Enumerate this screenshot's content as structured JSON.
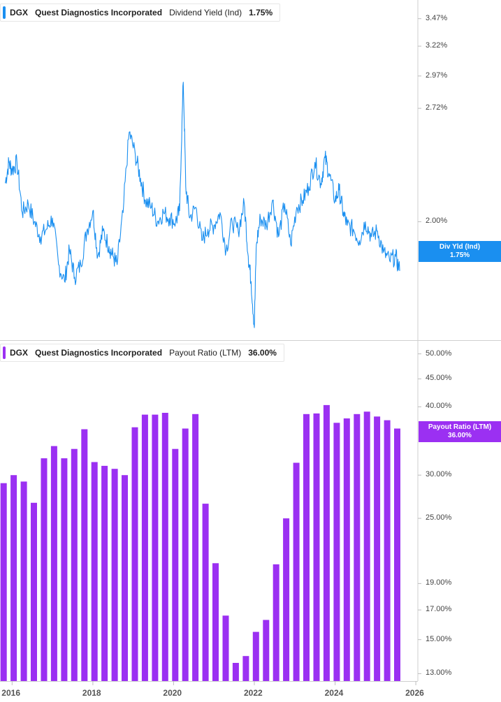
{
  "top_panel": {
    "ticker": "DGX",
    "company": "Quest Diagnostics Incorporated",
    "metric": "Dividend Yield (Ind)",
    "value": "1.75%",
    "flag_label": "Div Yld (Ind)",
    "flag_value": "1.75%",
    "color": "#1a8ff0"
  },
  "bottom_panel": {
    "ticker": "DGX",
    "company": "Quest Diagnostics Incorporated",
    "metric": "Payout Ratio (LTM)",
    "value": "36.00%",
    "flag_label": "Payout Ratio (LTM)",
    "flag_value": "36.00%",
    "color": "#9b30f2"
  },
  "chart_data": [
    {
      "type": "line",
      "scale": "log",
      "series": [
        {
          "name": "Dividend Yield (Ind)",
          "x": [
            2015.83,
            2015.92,
            2016.0,
            2016.12,
            2016.25,
            2016.4,
            2016.55,
            2016.7,
            2016.85,
            2017.0,
            2017.15,
            2017.3,
            2017.42,
            2017.55,
            2017.7,
            2017.85,
            2018.0,
            2018.12,
            2018.25,
            2018.4,
            2018.5,
            2018.6,
            2018.75,
            2018.9,
            2019.05,
            2019.18,
            2019.3,
            2019.45,
            2019.6,
            2019.75,
            2019.9,
            2020.05,
            2020.15,
            2020.24,
            2020.3,
            2020.4,
            2020.55,
            2020.7,
            2020.85,
            2021.0,
            2021.15,
            2021.3,
            2021.45,
            2021.6,
            2021.75,
            2021.85,
            2021.92,
            2022.0,
            2022.05,
            2022.15,
            2022.3,
            2022.45,
            2022.6,
            2022.75,
            2022.9,
            2023.05,
            2023.2,
            2023.35,
            2023.5,
            2023.65,
            2023.75,
            2023.85,
            2024.0,
            2024.1,
            2024.2,
            2024.3,
            2024.45,
            2024.6,
            2024.75,
            2024.9,
            2025.05,
            2025.2,
            2025.35,
            2025.5,
            2025.6
          ],
          "y": [
            2.22,
            2.35,
            2.3,
            2.35,
            2.05,
            2.1,
            2.0,
            1.92,
            1.96,
            2.02,
            1.78,
            1.7,
            1.85,
            1.72,
            1.78,
            1.95,
            2.06,
            1.82,
            1.95,
            1.87,
            1.82,
            1.78,
            2.05,
            2.55,
            2.4,
            2.25,
            2.12,
            2.08,
            2.0,
            2.05,
            2.02,
            2.0,
            2.06,
            2.92,
            2.2,
            2.02,
            2.08,
            1.9,
            1.96,
            1.98,
            2.05,
            1.85,
            2.0,
            1.95,
            2.1,
            1.82,
            1.7,
            1.5,
            1.88,
            2.02,
            1.98,
            2.12,
            1.92,
            2.1,
            1.88,
            2.08,
            2.12,
            2.2,
            2.35,
            2.22,
            2.38,
            2.28,
            2.12,
            2.18,
            2.05,
            1.98,
            1.96,
            1.9,
            2.0,
            1.92,
            1.95,
            1.84,
            1.8,
            1.82,
            1.75
          ]
        }
      ],
      "y_ticks": [
        "3.47%",
        "3.22%",
        "2.97%",
        "2.72%",
        "2.00%"
      ],
      "ylim": [
        1.45,
        3.65
      ]
    },
    {
      "type": "bar",
      "scale": "log",
      "series": [
        {
          "name": "Payout Ratio (LTM)",
          "x": [
            2015.79,
            2016.04,
            2016.29,
            2016.54,
            2016.79,
            2017.04,
            2017.29,
            2017.54,
            2017.79,
            2018.04,
            2018.29,
            2018.54,
            2018.79,
            2019.04,
            2019.29,
            2019.54,
            2019.79,
            2020.04,
            2020.29,
            2020.54,
            2020.79,
            2021.04,
            2021.29,
            2021.54,
            2021.79,
            2022.04,
            2022.29,
            2022.54,
            2022.79,
            2023.04,
            2023.29,
            2023.54,
            2023.79,
            2024.04,
            2024.29,
            2024.54,
            2024.79,
            2025.04,
            2025.29,
            2025.54
          ],
          "y": [
            29.0,
            30.0,
            29.2,
            26.7,
            32.2,
            33.9,
            32.2,
            33.5,
            36.4,
            31.7,
            31.2,
            30.8,
            30.0,
            36.7,
            38.7,
            38.7,
            39.0,
            33.5,
            36.5,
            38.8,
            26.6,
            20.7,
            16.6,
            13.6,
            14.0,
            15.5,
            16.3,
            20.6,
            25.0,
            31.6,
            38.8,
            38.9,
            40.3,
            37.4,
            38.1,
            38.8,
            39.2,
            38.4,
            37.8,
            36.5
          ]
        }
      ],
      "y_ticks": [
        "50.00%",
        "45.00%",
        "40.00%",
        "30.00%",
        "25.00%",
        "19.00%",
        "17.00%",
        "15.00%",
        "13.00%"
      ],
      "ylim": [
        12.6,
        52.5
      ]
    }
  ],
  "x_axis": {
    "ticks": [
      "2016",
      "2018",
      "2020",
      "2022",
      "2024",
      "2026"
    ],
    "range": [
      2015.7,
      2026.05
    ]
  }
}
